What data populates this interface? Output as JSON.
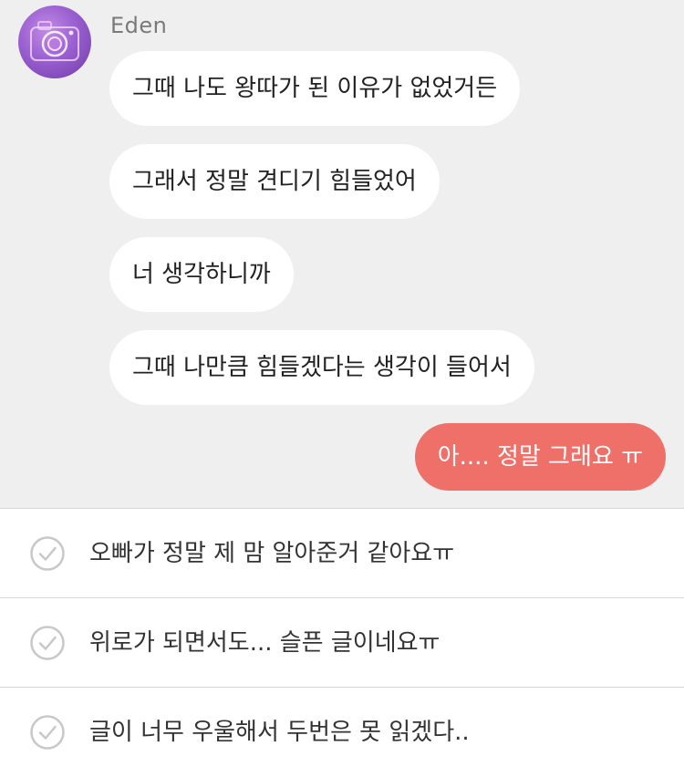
{
  "contact": {
    "name": "Eden",
    "avatar_icon": "camera-icon",
    "avatar_color": "#9a5fd0"
  },
  "messages": [
    {
      "from": "them",
      "text": "그때 나도 왕따가 된 이유가 없었거든"
    },
    {
      "from": "them",
      "text": "그래서 정말 견디기 힘들었어"
    },
    {
      "from": "them",
      "text": "너 생각하니까"
    },
    {
      "from": "them",
      "text": "그때 나만큼 힘들겠다는 생각이 들어서"
    },
    {
      "from": "me",
      "text": "아.... 정말 그래요 ㅠ"
    }
  ],
  "reply_options": [
    {
      "text": "오빠가 정말 제 맘 알아준거 같아요ㅠ",
      "icon": "check-circle-icon"
    },
    {
      "text": "위로가 되면서도... 슬픈 글이네요ㅠ",
      "icon": "check-circle-icon"
    },
    {
      "text": "글이 너무 우울해서 두번은 못 읽겠다..",
      "icon": "check-circle-icon"
    }
  ],
  "colors": {
    "chat_background": "#efefef",
    "incoming_bubble": "#ffffff",
    "outgoing_bubble": "#ef7068",
    "check_icon": "#c8c8c8"
  }
}
